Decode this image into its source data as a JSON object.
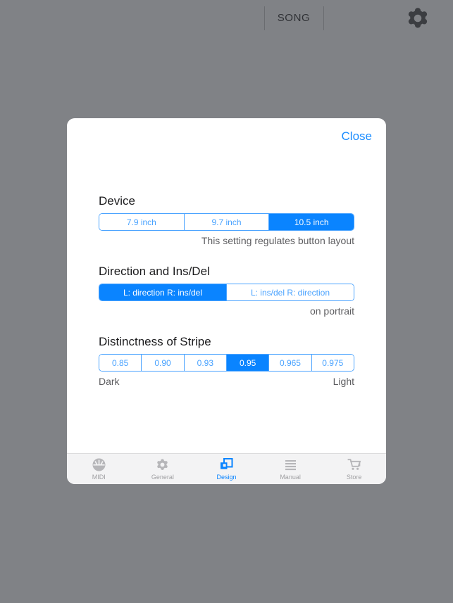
{
  "topbar": {
    "song_label": "SONG",
    "gear_icon": "gear-icon"
  },
  "modal": {
    "close_label": "Close",
    "sections": [
      {
        "title": "Device",
        "options": [
          "7.9 inch",
          "9.7 inch",
          "10.5 inch"
        ],
        "selected_index": 2,
        "helper": "This setting regulates button layout"
      },
      {
        "title": "Direction and Ins/Del",
        "options": [
          "L: direction   R: ins/del",
          "L: ins/del   R: direction"
        ],
        "selected_index": 0,
        "helper": "on portrait"
      },
      {
        "title": "Distinctness of Stripe",
        "options": [
          "0.85",
          "0.90",
          "0.93",
          "0.95",
          "0.965",
          "0.975"
        ],
        "selected_index": 3,
        "helper_left": "Dark",
        "helper_right": "Light"
      }
    ]
  },
  "tabbar": {
    "tabs": [
      {
        "label": "MIDI",
        "icon": "midi-keyboard-icon",
        "active": false
      },
      {
        "label": "General",
        "icon": "gear-icon",
        "active": false
      },
      {
        "label": "Design",
        "icon": "overlap-squares-icon",
        "active": true
      },
      {
        "label": "Manual",
        "icon": "list-lines-icon",
        "active": false
      },
      {
        "label": "Store",
        "icon": "shopping-cart-icon",
        "active": false
      }
    ]
  },
  "colors": {
    "accent": "#0a84ff",
    "accent_light": "#4aa3ff",
    "background": "#808286",
    "modal_background": "#ffffff",
    "tabbar_background": "#f3f3f4",
    "inactive_tab": "#a0a0a3"
  }
}
